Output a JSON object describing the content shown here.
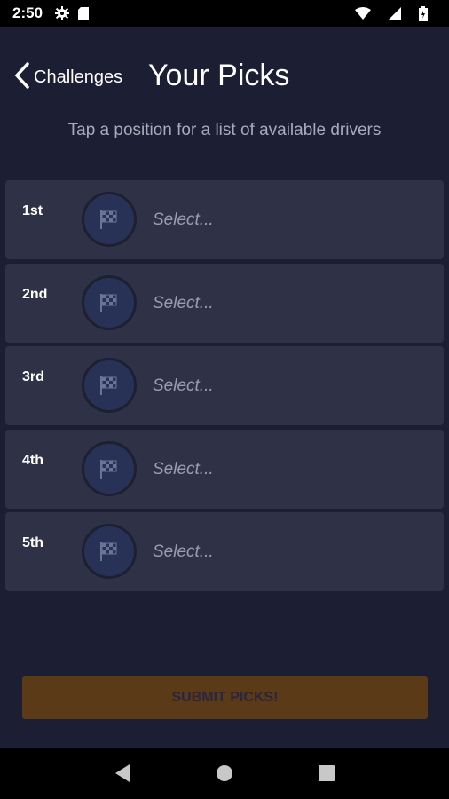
{
  "status_bar": {
    "time": "2:50",
    "icons": [
      "gear-icon",
      "sd-card-icon",
      "wifi-icon",
      "signal-icon",
      "battery-icon"
    ]
  },
  "header": {
    "back_label": "Challenges",
    "title": "Your Picks"
  },
  "subtitle": "Tap a position for a list of available drivers",
  "picks": [
    {
      "position": "1st",
      "placeholder": "Select..."
    },
    {
      "position": "2nd",
      "placeholder": "Select..."
    },
    {
      "position": "3rd",
      "placeholder": "Select..."
    },
    {
      "position": "4th",
      "placeholder": "Select..."
    },
    {
      "position": "5th",
      "placeholder": "Select..."
    }
  ],
  "submit_label": "SUBMIT PICKS!",
  "colors": {
    "background": "#1c1f33",
    "row_background": "#2f3246",
    "flag_circle": "#283257",
    "submit_background": "#5a3a17"
  },
  "nav_bar": {
    "icons": [
      "back-triangle-icon",
      "home-circle-icon",
      "recents-square-icon"
    ]
  }
}
